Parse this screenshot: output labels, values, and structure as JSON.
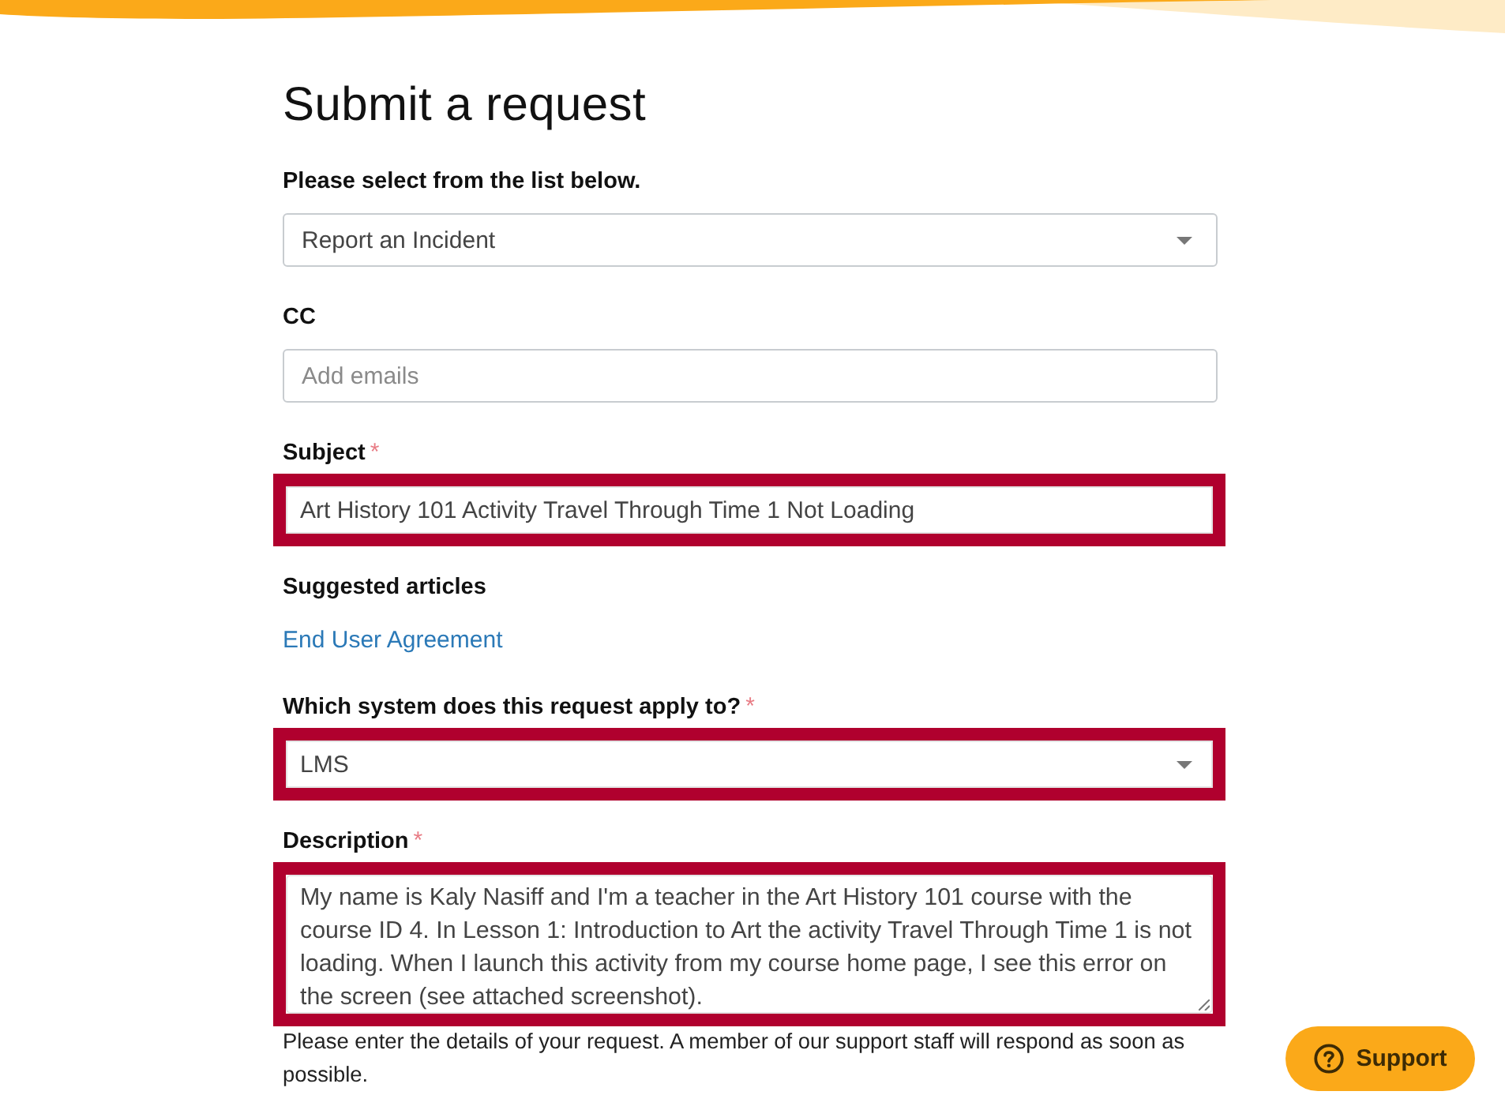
{
  "page": {
    "title": "Submit a request"
  },
  "form": {
    "fields": [
      {
        "kind": "select",
        "label": "Please select from the list below.",
        "value": "Report an Incident",
        "highlighted": false
      },
      {
        "kind": "text",
        "label": "CC",
        "placeholder": "Add emails",
        "highlighted": false
      },
      {
        "kind": "text",
        "label": "Subject",
        "required_mark": "*",
        "value": "Art History 101 Activity Travel Through Time 1 Not Loading",
        "highlighted": true
      },
      {
        "kind": "links",
        "label": "Suggested articles",
        "links": [
          "End User Agreement"
        ]
      },
      {
        "kind": "select",
        "label": "Which system does this request apply to?",
        "required_mark": "*",
        "value": "LMS",
        "highlighted": true
      },
      {
        "kind": "textarea",
        "label": "Description",
        "required_mark": "*",
        "value": "My name is Kaly Nasiff and I'm a teacher in the Art History 101 course with the course ID 4. In Lesson 1: Introduction to Art the activity Travel Through Time 1 is not loading. When I launch this activity from my course home page, I see this error on the screen (see attached screenshot).",
        "highlighted": true,
        "hint": "Please enter the details of your request. A member of our support staff will respond as soon as possible."
      }
    ]
  },
  "support_button": {
    "label": "Support"
  }
}
